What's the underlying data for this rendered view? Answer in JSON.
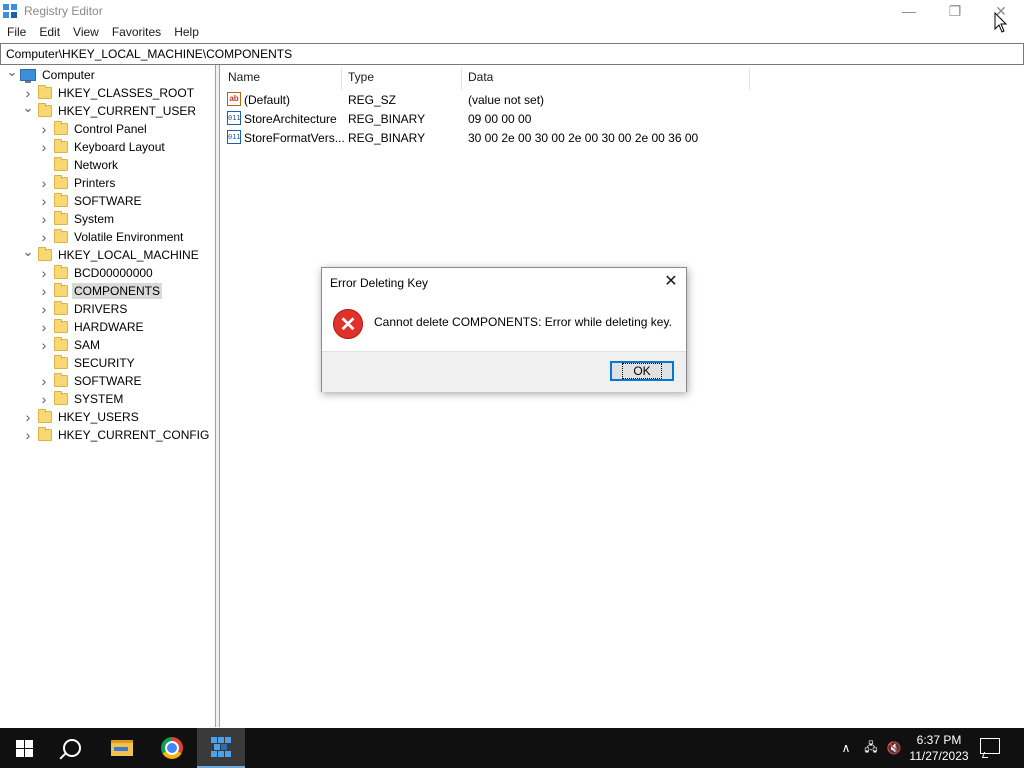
{
  "window": {
    "title": "Registry Editor",
    "minimize_glyph": "—",
    "restore_glyph": "❐",
    "close_glyph": "✕"
  },
  "menu": [
    "File",
    "Edit",
    "View",
    "Favorites",
    "Help"
  ],
  "address": "Computer\\HKEY_LOCAL_MACHINE\\COMPONENTS",
  "tree": [
    {
      "label": "Computer",
      "icon": "computer-icon",
      "expander": "expanded",
      "selected": false
    },
    {
      "label": "HKEY_CLASSES_ROOT",
      "icon": "folder-icon",
      "expander": "collapsed",
      "selected": false
    },
    {
      "label": "HKEY_CURRENT_USER",
      "icon": "folder-icon",
      "expander": "expanded",
      "selected": false
    },
    {
      "label": "Control Panel",
      "icon": "folder-icon",
      "expander": "collapsed",
      "selected": false
    },
    {
      "label": "Keyboard Layout",
      "icon": "folder-icon",
      "expander": "collapsed",
      "selected": false
    },
    {
      "label": "Network",
      "icon": "folder-icon",
      "expander": "none",
      "selected": false
    },
    {
      "label": "Printers",
      "icon": "folder-icon",
      "expander": "collapsed",
      "selected": false
    },
    {
      "label": "SOFTWARE",
      "icon": "folder-icon",
      "expander": "collapsed",
      "selected": false
    },
    {
      "label": "System",
      "icon": "folder-icon",
      "expander": "collapsed",
      "selected": false
    },
    {
      "label": "Volatile Environment",
      "icon": "folder-icon",
      "expander": "collapsed",
      "selected": false
    },
    {
      "label": "HKEY_LOCAL_MACHINE",
      "icon": "folder-icon",
      "expander": "expanded",
      "selected": false
    },
    {
      "label": "BCD00000000",
      "icon": "folder-icon",
      "expander": "collapsed",
      "selected": false
    },
    {
      "label": "COMPONENTS",
      "icon": "folder-icon",
      "expander": "collapsed",
      "selected": true
    },
    {
      "label": "DRIVERS",
      "icon": "folder-icon",
      "expander": "collapsed",
      "selected": false
    },
    {
      "label": "HARDWARE",
      "icon": "folder-icon",
      "expander": "collapsed",
      "selected": false
    },
    {
      "label": "SAM",
      "icon": "folder-icon",
      "expander": "collapsed",
      "selected": false
    },
    {
      "label": "SECURITY",
      "icon": "folder-icon",
      "expander": "none",
      "selected": false
    },
    {
      "label": "SOFTWARE",
      "icon": "folder-icon",
      "expander": "collapsed",
      "selected": false
    },
    {
      "label": "SYSTEM",
      "icon": "folder-icon",
      "expander": "collapsed",
      "selected": false
    },
    {
      "label": "HKEY_USERS",
      "icon": "folder-icon",
      "expander": "collapsed",
      "selected": false
    },
    {
      "label": "HKEY_CURRENT_CONFIG",
      "icon": "folder-icon",
      "expander": "collapsed",
      "selected": false
    }
  ],
  "list": {
    "headers": {
      "name": "Name",
      "type": "Type",
      "data": "Data"
    },
    "rows": [
      {
        "name": "(Default)",
        "type": "REG_SZ",
        "data": "(value not set)",
        "icon": "string-value-icon",
        "icon_text": "ab"
      },
      {
        "name": "StoreArchitecture",
        "type": "REG_BINARY",
        "data": "09 00 00 00",
        "icon": "binary-value-icon",
        "icon_text": "011"
      },
      {
        "name": "StoreFormatVers...",
        "type": "REG_BINARY",
        "data": "30 00 2e 00 30 00 2e 00 30 00 2e 00 36 00",
        "icon": "binary-value-icon",
        "icon_text": "011"
      }
    ]
  },
  "dialog": {
    "title": "Error Deleting Key",
    "message": "Cannot delete COMPONENTS:  Error while deleting key.",
    "ok_label": "OK",
    "close_glyph": "✕",
    "icon_glyph": "✕"
  },
  "taskbar": {
    "time": "6:37 PM",
    "date": "11/27/2023",
    "tray_chevron": "∧",
    "network_glyph": "🖧",
    "volume_glyph": "🔇"
  }
}
